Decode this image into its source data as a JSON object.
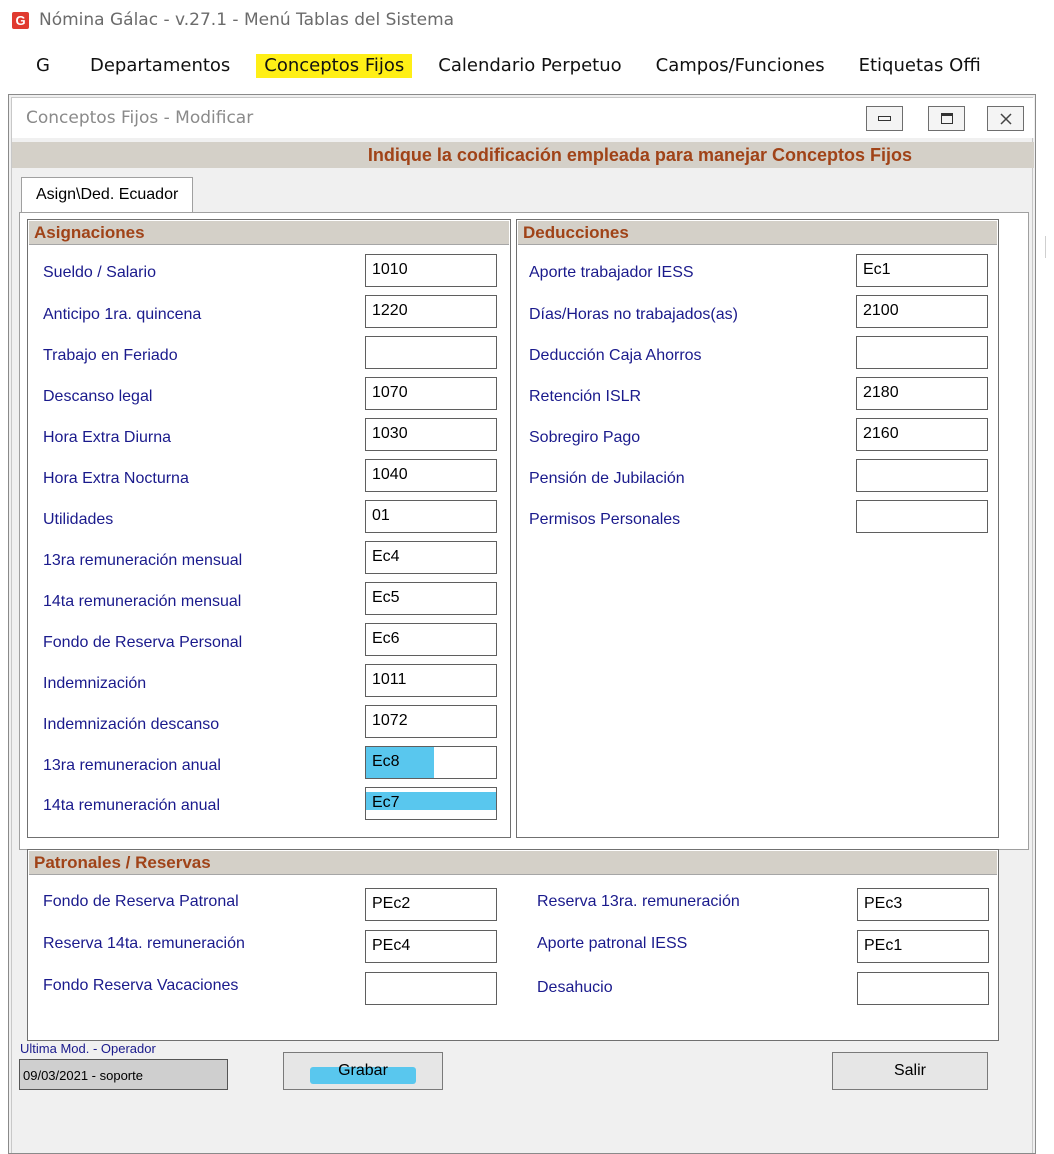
{
  "app": {
    "title": "Nómina Gálac  - v.27.1 - Menú Tablas del Sistema",
    "logo_letter": "G"
  },
  "menu": [
    {
      "label": "G",
      "highlighted": false
    },
    {
      "label": "Departamentos",
      "highlighted": false
    },
    {
      "label": "Conceptos Fijos",
      "highlighted": true
    },
    {
      "label": "Calendario Perpetuo",
      "highlighted": false
    },
    {
      "label": "Campos/Funciones",
      "highlighted": false
    },
    {
      "label": "Etiquetas Offi",
      "highlighted": false
    }
  ],
  "window": {
    "title": "Conceptos Fijos - Modificar",
    "banner": "Indique la codificación empleada para manejar Conceptos Fijos",
    "tab": "Asign\\Ded. Ecuador"
  },
  "asignaciones": {
    "header": "Asignaciones",
    "rows": [
      {
        "label": "Sueldo / Salario",
        "value": "1010"
      },
      {
        "label": "Anticipo 1ra. quincena",
        "value": "1220"
      },
      {
        "label": "Trabajo en Feriado",
        "value": ""
      },
      {
        "label": "Descanso legal",
        "value": "1070"
      },
      {
        "label": "Hora Extra Diurna",
        "value": "1030"
      },
      {
        "label": "Hora Extra Nocturna",
        "value": "1040"
      },
      {
        "label": "Utilidades",
        "value": "01"
      },
      {
        "label": "13ra  remuneración mensual",
        "value": "Ec4"
      },
      {
        "label": "14ta remuneración mensual",
        "value": "Ec5"
      },
      {
        "label": "Fondo de Reserva Personal",
        "value": "Ec6"
      },
      {
        "label": "Indemnización",
        "value": "1011"
      },
      {
        "label": "Indemnización descanso",
        "value": "1072"
      },
      {
        "label": "13ra remuneracion anual",
        "value": "Ec8"
      },
      {
        "label": "14ta remuneración anual",
        "value": "Ec7"
      }
    ]
  },
  "deducciones": {
    "header": "Deducciones",
    "rows": [
      {
        "label": "Aporte trabajador IESS",
        "value": "Ec1"
      },
      {
        "label": "Días/Horas no trabajados(as)",
        "value": "2100"
      },
      {
        "label": "Deducción Caja Ahorros",
        "value": ""
      },
      {
        "label": "Retención ISLR",
        "value": "2180"
      },
      {
        "label": "Sobregiro Pago",
        "value": "2160"
      },
      {
        "label": "Pensión de Jubilación",
        "value": ""
      },
      {
        "label": "Permisos Personales",
        "value": ""
      }
    ]
  },
  "patronales": {
    "header": "Patronales / Reservas",
    "left": [
      {
        "label": "Fondo de Reserva Patronal",
        "value": "PEc2"
      },
      {
        "label": "Reserva 14ta. remuneración",
        "value": "PEc4"
      },
      {
        "label": "Fondo Reserva Vacaciones",
        "value": ""
      }
    ],
    "right": [
      {
        "label": "Reserva 13ra. remuneración",
        "value": "PEc3"
      },
      {
        "label": "Aporte patronal IESS",
        "value": "PEc1"
      },
      {
        "label": "Desahucio",
        "value": ""
      }
    ]
  },
  "footer": {
    "last_mod_label": "Ultima Mod. - Operador",
    "last_mod_value": "09/03/2021 - soporte",
    "save_label": "Grabar",
    "exit_label": "Salir"
  },
  "colors": {
    "menu_highlight": "#ffef16",
    "marker_highlight": "#59c7ee",
    "section_header_text": "#a04318",
    "field_label_text": "#1a1a8c"
  }
}
